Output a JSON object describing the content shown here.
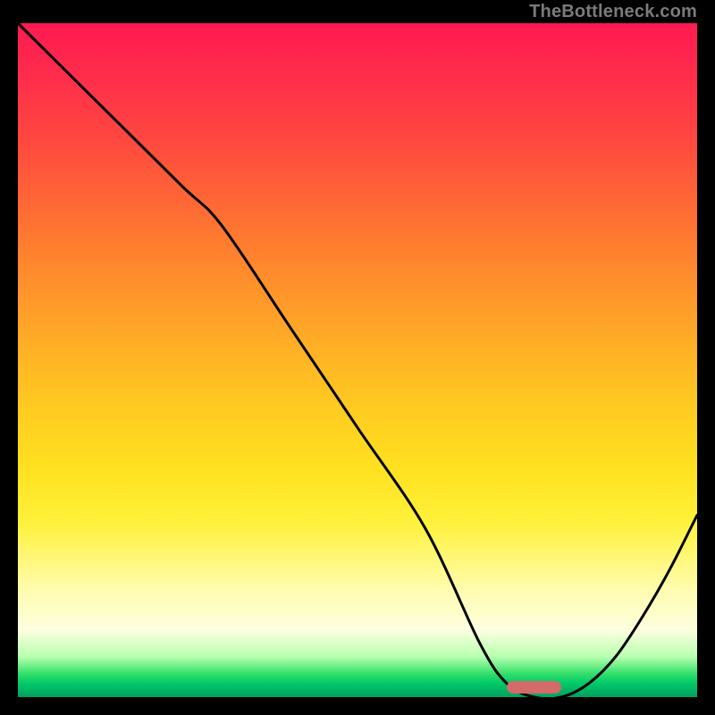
{
  "watermark": "TheBottleneck.com",
  "chart_data": {
    "type": "line",
    "title": "",
    "xlabel": "",
    "ylabel": "",
    "xlim": [
      0,
      100
    ],
    "ylim": [
      0,
      100
    ],
    "grid": false,
    "legend": false,
    "series": [
      {
        "name": "bottleneck-curve",
        "x": [
          0,
          12,
          24,
          30,
          40,
          50,
          60,
          68,
          72,
          76,
          80,
          84,
          88,
          92,
          96,
          100
        ],
        "values": [
          100,
          88,
          76,
          70,
          55,
          40,
          25,
          8,
          2,
          0,
          0,
          2,
          6,
          12,
          19,
          27
        ]
      }
    ],
    "marker": {
      "name": "optimal-range",
      "x_start": 72,
      "x_end": 80,
      "y": 1.5,
      "color": "#d46a6a"
    },
    "background_gradient": {
      "top": "#ff1a52",
      "upper_mid": "#ffa628",
      "mid": "#ffe11f",
      "lower_mid": "#fdffe0",
      "bottom": "#00c86a"
    }
  }
}
